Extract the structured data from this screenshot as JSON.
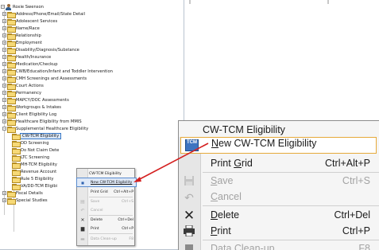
{
  "tree": {
    "root_label": "Roxie Swenson",
    "items": [
      {
        "label": "Address/Phone/Email/State Detail"
      },
      {
        "label": "Adolescent Services"
      },
      {
        "label": "Name/Race"
      },
      {
        "label": "Relationship"
      },
      {
        "label": "Employment"
      },
      {
        "label": "Disability/Diagnosis/Substance"
      },
      {
        "label": "Health/Insurance"
      },
      {
        "label": "Medication/Checkup"
      },
      {
        "label": "CWB/Education/Infant and Toddler Intervention"
      },
      {
        "label": "CMH Screenings and Assessments"
      },
      {
        "label": "Court Actions"
      },
      {
        "label": "Permanency"
      },
      {
        "label": "MAPCY/DOC Assessments"
      },
      {
        "label": "Workgroups & Intakes"
      },
      {
        "label": "Client Eligibility Log"
      },
      {
        "label": "Healthcare Eligibility from MMIS"
      },
      {
        "label": "Supplemental Healthcare Eligibility"
      }
    ],
    "children": [
      {
        "label": "CW-TCM Eligibility"
      },
      {
        "label": "DD Screening"
      },
      {
        "label": "Do Not Claim Dete"
      },
      {
        "label": "LTC Screening"
      },
      {
        "label": "MH-TCM Eligibility"
      },
      {
        "label": "Revenue Account"
      },
      {
        "label": "Rule 5 Eligibility"
      },
      {
        "label": "VA/DD-TCM Eligibi"
      }
    ],
    "after": [
      {
        "label": "Fiscal Details"
      },
      {
        "label": "Special Studies"
      }
    ]
  },
  "small_menu": {
    "header": "CW-TCM Eligibility",
    "items": [
      {
        "label": "New CW-TCM Eligibility",
        "shortcut": ""
      },
      {
        "label": "Print Grid",
        "shortcut": "Ctrl+Alt+P"
      },
      {
        "label": "Save",
        "shortcut": "Ctrl+S"
      },
      {
        "label": "Cancel",
        "shortcut": ""
      },
      {
        "label": "Delete",
        "shortcut": "Ctrl+Del"
      },
      {
        "label": "Print",
        "shortcut": "Ctrl+P"
      },
      {
        "label": "Data Clean-up",
        "shortcut": "F8"
      }
    ]
  },
  "big_menu": {
    "header": "CW-TCM Eligibility",
    "new_icon_text": "TCM",
    "new": {
      "pre": "",
      "underlined": "N",
      "post": "ew CW-TCM Eligibility"
    },
    "print_grid": {
      "pre": "Print ",
      "underlined": "G",
      "post": "rid",
      "shortcut": "Ctrl+Alt+P"
    },
    "save": {
      "pre": "",
      "underlined": "S",
      "post": "ave",
      "shortcut": "Ctrl+S"
    },
    "cancel": {
      "pre": "",
      "underlined": "C",
      "post": "ancel"
    },
    "delete": {
      "pre": "",
      "underlined": "D",
      "post": "elete",
      "shortcut": "Ctrl+Del"
    },
    "print": {
      "pre": "",
      "underlined": "P",
      "post": "rint",
      "shortcut": "Ctrl+P"
    },
    "clean": {
      "pre": "Dat",
      "underlined": "a",
      "post": " Clean-up",
      "shortcut": "F8"
    }
  },
  "colors": {
    "highlight_border": "#e6a93a",
    "arrow": "#d42020",
    "selection": "#d8e6f7"
  },
  "icons": {
    "save": "floppy-disk-icon",
    "cancel": "undo-icon",
    "delete": "x-icon",
    "print": "printer-icon",
    "clean": "eraser-icon"
  }
}
